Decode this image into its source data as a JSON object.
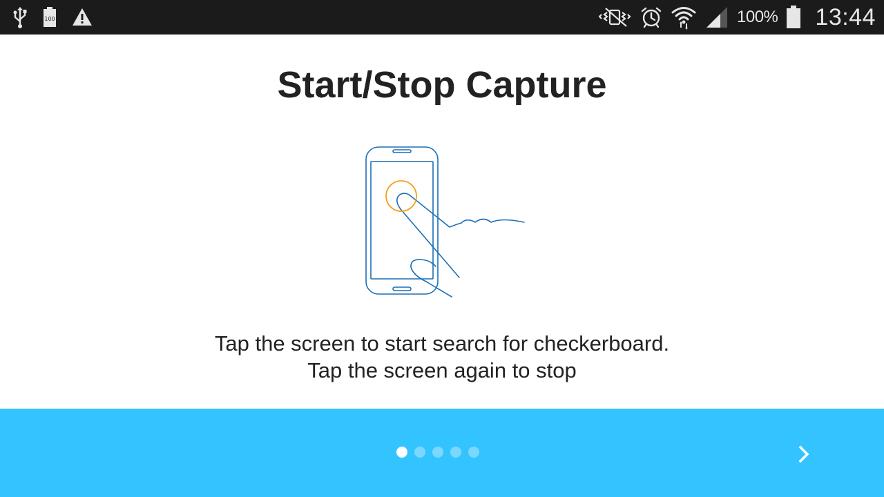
{
  "status_bar": {
    "left_icons": [
      "usb-icon",
      "battery-100-notification-icon",
      "warning-icon"
    ],
    "right_icons": [
      "mute-vibrate-icon",
      "alarm-icon",
      "wifi-icon",
      "signal-icon",
      "battery-icon"
    ],
    "battery_percent": "100%",
    "time": "13:44"
  },
  "main": {
    "title": "Start/Stop Capture",
    "illustration": "phone-tap-illustration",
    "description_line1": "Tap the screen to start search for checkerboard.",
    "description_line2": "Tap the screen again to stop"
  },
  "footer": {
    "page_count": 5,
    "current_page": 1,
    "next_icon": "chevron-right-icon"
  },
  "colors": {
    "status_bar_bg": "#1b1b1b",
    "footer_bg": "#33c4ff",
    "illustration_stroke": "#1a6fb5",
    "tap_circle": "#f5a020",
    "text": "#222222"
  }
}
